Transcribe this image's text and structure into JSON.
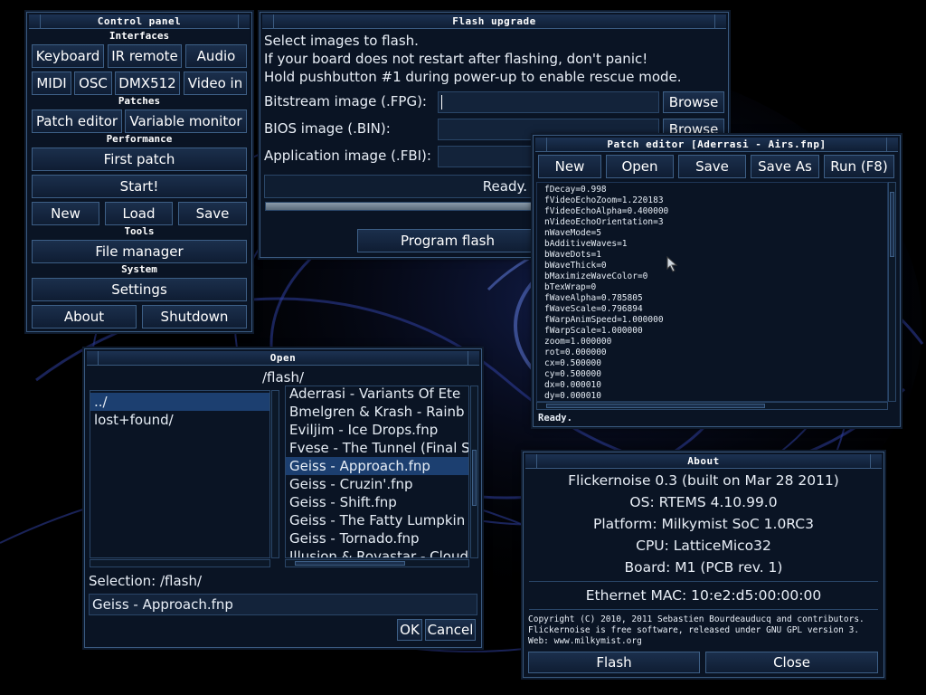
{
  "colors": {
    "accent": "#3d5f86",
    "selection": "#1c3f70",
    "window_bg": "#0a1424"
  },
  "control_panel": {
    "title": "Control panel",
    "sections": {
      "interfaces": "Interfaces",
      "patches": "Patches",
      "performance": "Performance",
      "tools": "Tools",
      "system": "System"
    },
    "buttons": {
      "keyboard": "Keyboard",
      "ir_remote": "IR remote",
      "audio": "Audio",
      "midi": "MIDI",
      "osc": "OSC",
      "dmx512": "DMX512",
      "video_in": "Video in",
      "patch_editor": "Patch editor",
      "variable_monitor": "Variable monitor",
      "first_patch": "First patch",
      "start": "Start!",
      "new": "New",
      "load": "Load",
      "save": "Save",
      "file_manager": "File manager",
      "settings": "Settings",
      "about": "About",
      "shutdown": "Shutdown"
    }
  },
  "flash_upgrade": {
    "title": "Flash upgrade",
    "lines": [
      "Select images to flash.",
      "If your board does not restart after flashing, don't panic!",
      "Hold pushbutton #1 during power-up to enable rescue mode."
    ],
    "bitstream_label": "Bitstream image (.FPG):",
    "bios_label": "BIOS image (.BIN):",
    "application_label": "Application image (.FBI):",
    "browse": "Browse",
    "status": "Ready.",
    "progress": 0,
    "program_button": "Program flash"
  },
  "patch_editor": {
    "title": "Patch editor [Aderrasi - Airs.fnp]",
    "buttons": {
      "new": "New",
      "open": "Open",
      "save": "Save",
      "save_as": "Save As",
      "run": "Run (F8)"
    },
    "code": [
      "fDecay=0.998",
      "fVideoEchoZoom=1.220183",
      "fVideoEchoAlpha=0.400000",
      "nVideoEchoOrientation=3",
      "nWaveMode=5",
      "bAdditiveWaves=1",
      "bWaveDots=1",
      "bWaveThick=0",
      "bMaximizeWaveColor=0",
      "bTexWrap=0",
      "fWaveAlpha=0.785805",
      "fWaveScale=0.796894",
      "fWarpAnimSpeed=1.000000",
      "fWarpScale=1.000000",
      "zoom=1.000000",
      "rot=0.000000",
      "cx=0.500000",
      "cy=0.500000",
      "dx=0.000010",
      "dy=0.000010"
    ],
    "status": "Ready."
  },
  "open_dialog": {
    "title": "Open",
    "path": "/flash/",
    "folders": [
      "../",
      "lost+found/"
    ],
    "files": [
      "Aderrasi - Variants Of Ete",
      "Bmelgren & Krash - Rainb",
      "Eviljim - Ice Drops.fnp",
      "Fvese - The Tunnel (Final S",
      "Geiss - Approach.fnp",
      "Geiss - Cruzin'.fnp",
      "Geiss - Shift.fnp",
      "Geiss - The Fatty Lumpkin",
      "Geiss - Tornado.fnp",
      "Illusion & Rovastar - Cloud"
    ],
    "selection_label": "Selection:  /flash/",
    "filename_value": "Geiss - Approach.fnp",
    "ok": "OK",
    "cancel": "Cancel"
  },
  "about": {
    "title": "About",
    "product": "Flickernoise 0.3 (built on Mar 28 2011)",
    "os": "OS: RTEMS 4.10.99.0",
    "platform": "Platform: Milkymist SoC 1.0RC3",
    "cpu": "CPU: LatticeMico32",
    "board": "Board: M1 (PCB rev. 1)",
    "mac": "Ethernet MAC: 10:e2:d5:00:00:00",
    "copyright": [
      "Copyright (C) 2010, 2011 Sebastien Bourdeauducq and contributors.",
      "Flickernoise is free software, released under GNU GPL version 3.",
      "Web: www.milkymist.org"
    ],
    "flash_button": "Flash",
    "close_button": "Close"
  }
}
